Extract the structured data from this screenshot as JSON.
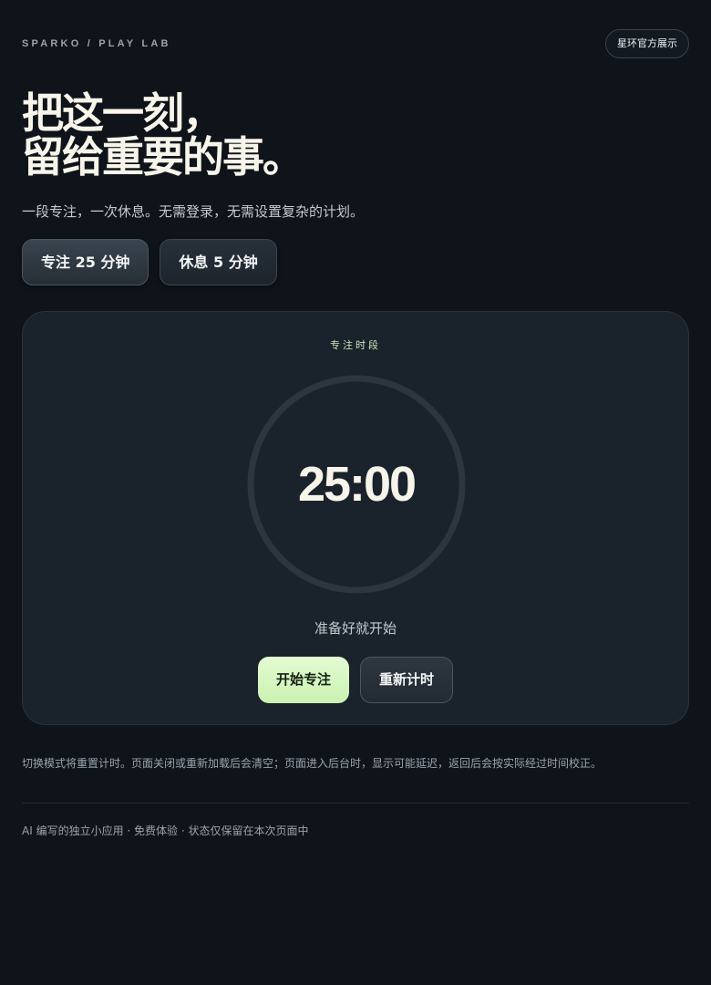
{
  "header": {
    "brand": "SPARKO / PLAY LAB",
    "showcase_button": "星环官方展示"
  },
  "hero": {
    "title_line1": "把这一刻，",
    "title_line2": "留给重要的事。",
    "subtitle": "一段专注，一次休息。无需登录，无需设置复杂的计划。"
  },
  "modes": {
    "focus_label": "专注 25 分钟",
    "break_label": "休息 5 分钟",
    "active": "focus"
  },
  "timer": {
    "phase_label": "专注时段",
    "time": "25:00",
    "progress": 0,
    "status": "准备好就开始",
    "start_label": "开始专注",
    "reset_label": "重新计时"
  },
  "note": "切换模式将重置计时。页面关闭或重新加载后会清空；页面进入后台时，显示可能延迟，返回后会按实际经过时间校正。",
  "footer": "AI 编写的独立小应用 · 免费体验 · 状态仅保留在本次页面中",
  "colors": {
    "background": "#0f141a",
    "card": "#1a222b",
    "accent": "#d4f7c0",
    "ring": "#2c363e"
  }
}
